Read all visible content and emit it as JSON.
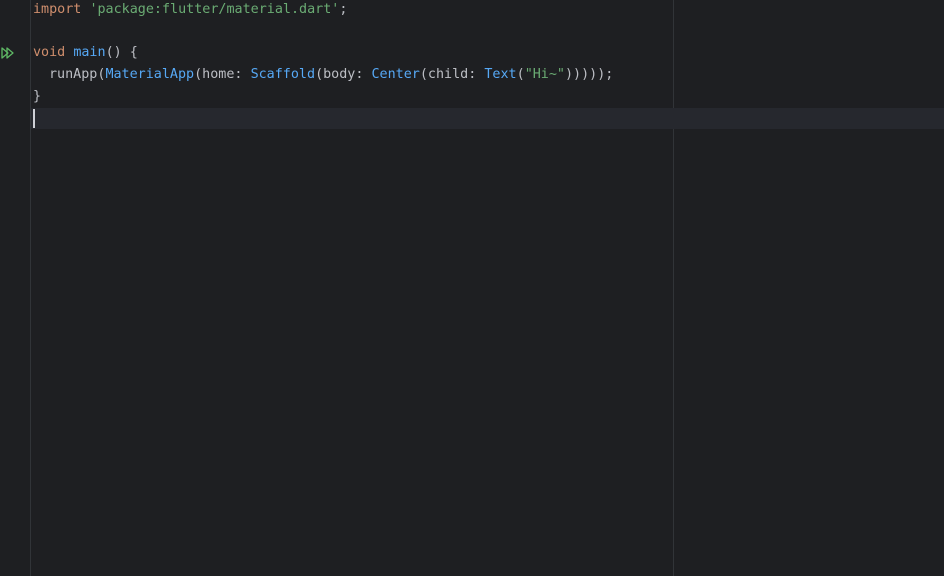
{
  "editor": {
    "lines": [
      {
        "tokens": [
          {
            "text": "import",
            "kind": "kw"
          },
          {
            "text": " ",
            "kind": "plain"
          },
          {
            "text": "'package:flutter/material.dart'",
            "kind": "str"
          },
          {
            "text": ";",
            "kind": "plain"
          }
        ]
      },
      {
        "tokens": []
      },
      {
        "tokens": [
          {
            "text": "void",
            "kind": "kw"
          },
          {
            "text": " ",
            "kind": "plain"
          },
          {
            "text": "main",
            "kind": "fn"
          },
          {
            "text": "() {",
            "kind": "plain"
          }
        ]
      },
      {
        "tokens": [
          {
            "text": "runApp(",
            "kind": "plain"
          },
          {
            "text": "MaterialApp",
            "kind": "cls"
          },
          {
            "text": "(home: ",
            "kind": "plain"
          },
          {
            "text": "Scaffold",
            "kind": "cls"
          },
          {
            "text": "(body: ",
            "kind": "plain"
          },
          {
            "text": "Center",
            "kind": "cls"
          },
          {
            "text": "(child: ",
            "kind": "plain"
          },
          {
            "text": "Text",
            "kind": "cls"
          },
          {
            "text": "(",
            "kind": "plain"
          },
          {
            "text": "\"Hi~\"",
            "kind": "str"
          },
          {
            "text": ")))));",
            "kind": "plain"
          }
        ]
      },
      {
        "tokens": [
          {
            "text": "}",
            "kind": "plain"
          }
        ]
      },
      {
        "tokens": []
      }
    ]
  },
  "gutter": {
    "run_icon": "run-icon"
  },
  "colors": {
    "background": "#1e1f22",
    "keyword": "#cf8e6d",
    "string": "#6aab73",
    "function": "#56a8f5",
    "plain": "#bcbec4",
    "run_icon": "#5fb865"
  }
}
